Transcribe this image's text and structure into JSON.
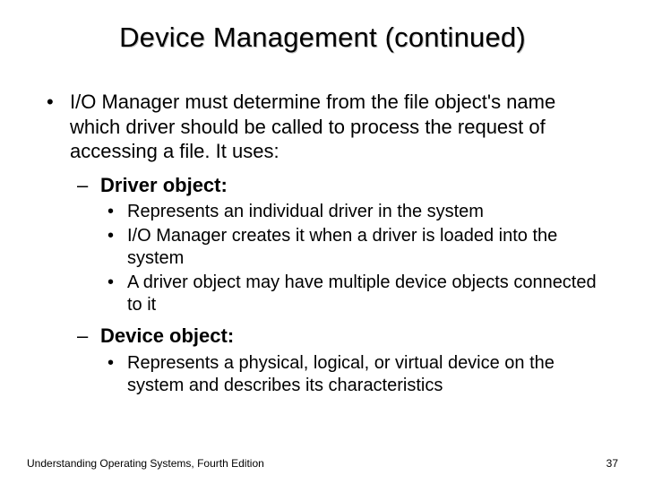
{
  "title": "Device Management (continued)",
  "main_bullet": "I/O Manager must determine from the file object's name which driver should be called to process the request of accessing a file. It uses:",
  "sub": [
    {
      "label": "Driver object:",
      "points": [
        "Represents an individual driver in the system",
        "I/O Manager creates it when a driver is loaded into the system",
        "A driver object may have multiple device objects connected to it"
      ]
    },
    {
      "label": "Device object:",
      "points": [
        "Represents a physical, logical, or virtual device on the system and describes its characteristics"
      ]
    }
  ],
  "footer_left": "Understanding Operating Systems, Fourth Edition",
  "footer_right": "37"
}
